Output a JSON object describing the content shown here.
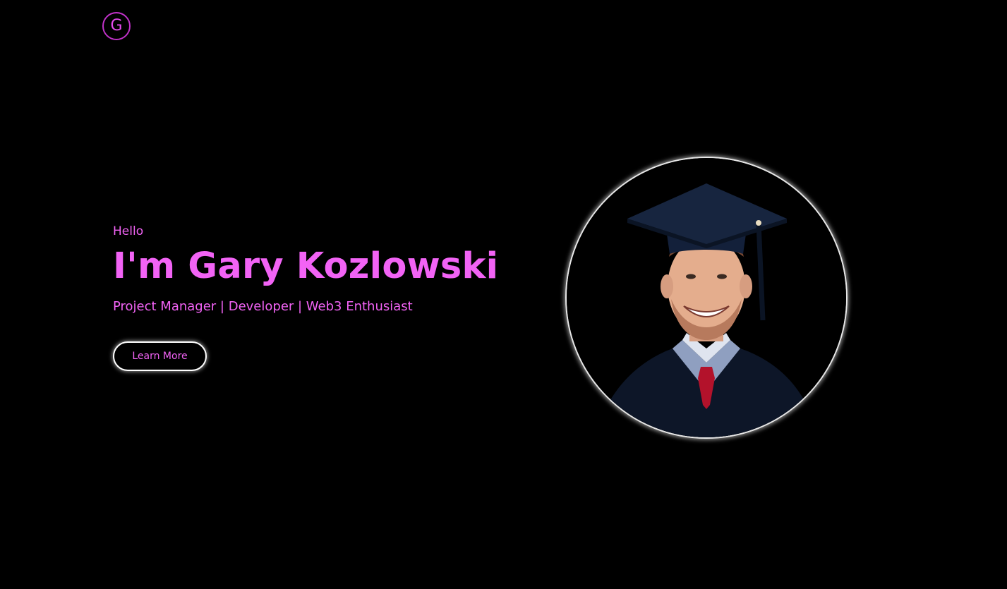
{
  "header": {
    "logo_letter": "G"
  },
  "hero": {
    "greeting": "Hello",
    "name": "I'm Gary Kozlowski",
    "tagline": "Project Manager | Developer | Web3 Enthusiast",
    "cta_label": "Learn More"
  },
  "profile_image": {
    "icon": "graduate-portrait"
  },
  "colors": {
    "background": "#000000",
    "accent": "#f263f5",
    "logo_border": "#c032c8",
    "button_border": "#ffffff"
  }
}
